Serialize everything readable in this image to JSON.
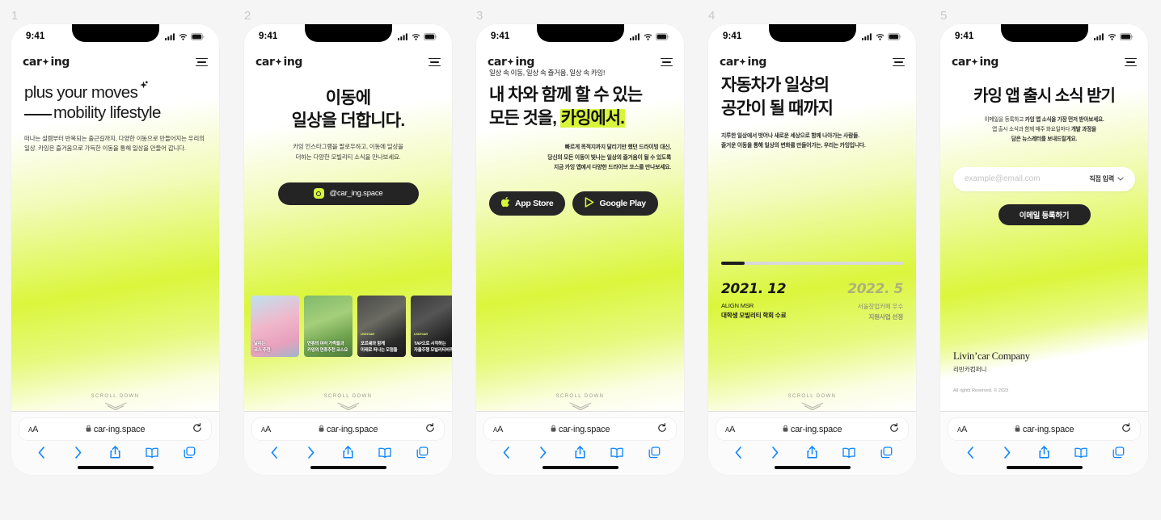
{
  "brand": {
    "logo_pre": "car",
    "logo_post": "ing",
    "accent": "#d8f53c",
    "dark": "#242424"
  },
  "safari": {
    "aa_label": "AA",
    "url": "car-ing.space",
    "lock_icon": "lock-icon",
    "reload_icon": "reload-icon",
    "back_icon": "back-chevron-icon",
    "forward_icon": "forward-chevron-icon",
    "share_icon": "share-icon",
    "bookmarks_icon": "book-icon",
    "tabs_icon": "tabs-icon"
  },
  "status": {
    "time": "9:41",
    "cellular_icon": "cellular-bars-icon",
    "wifi_icon": "wifi-icon",
    "battery_icon": "battery-icon"
  },
  "scroll_hint": {
    "label": "SCROLL DOWN",
    "icon": "chevron-down-icon"
  },
  "frames": [
    {
      "number": "1",
      "headline_line1": "plus your moves",
      "headline_line2": "mobility lifestyle",
      "body": "떠나는 설렘부터 반복되는 출근길까지, 다양한 이동으로 만들어지는 우리의 일상. 카잉은 즐거움으로 가득한 이동을 통해 일상을 만들어 갑니다."
    },
    {
      "number": "2",
      "headline_line1": "이동에",
      "headline_line2": "일상을 더합니다.",
      "sub_line1": "카잉 인스타그램을 팔로우하고, 이동에 일상을",
      "sub_line2": "더하는 다양한 모빌리티 소식을 만나보세요.",
      "instagram_handle": "@car_ing.space",
      "thumbs": [
        {
          "eyebrow": "",
          "caption_line1": "날리는",
          "caption_line2": "코스 추천"
        },
        {
          "eyebrow": "",
          "caption_line1": "연휴의 여러 가족들과",
          "caption_line2": "카잉의 연휴추천 코스요"
        },
        {
          "eyebrow": "LIVIN'CAR",
          "caption_line1": "포르쉐와 함께",
          "caption_line2": "미래로 떠나는 모험들"
        },
        {
          "eyebrow": "LIVIN'CAR",
          "caption_line1": "TAP으로 시작하는",
          "caption_line2": "자율주행 모빌리티바퀴"
        }
      ]
    },
    {
      "number": "3",
      "eyebrow": "일상 속 이동, 일상 속 즐거움, 일상 속 카잉!",
      "headline_line1": "내 차와 함께 할 수 있는",
      "headline_line2_plain": "모든 것을, ",
      "headline_line2_highlight": "카잉에서.",
      "body_line1": "빠르게 목적지까지 달리기만 했던 드라이빙 대신,",
      "body_line2": "당신의 모든 이동이 빛나는 일상의 즐거움이 될 수 있도록",
      "body_line3": "지금 카잉 앱에서 다양한 드라이브 코스를 만나보세요.",
      "appstore_label": "App Store",
      "googleplay_label": "Google Play"
    },
    {
      "number": "4",
      "headline_line1": "자동차가 일상의",
      "headline_line2": "공간이 될 때까지",
      "body_line1": "지루한 일상에서 벗어나 새로운 세상으로 함께 나아가는 사람들.",
      "body_line2": "즐거운 이동을 통해 일상의 변화를 만들어가는, 우리는 카잉입니다.",
      "timeline": [
        {
          "year": "2021. 12",
          "line1": "ALIGN MSR",
          "line2": "대학생 모빌리티 학회 수료",
          "dim": false
        },
        {
          "year": "2022. 5",
          "line1": "서울창업카페 우수",
          "line2": "지원사업 선정",
          "dim": true
        }
      ],
      "progress_percent": 13
    },
    {
      "number": "5",
      "headline": "카잉 앱 출시 소식 받기",
      "sub_line1_a": "이메일을 등록하고 ",
      "sub_line1_b": "카잉 앱 소식을 가장 먼저 받아보세요.",
      "sub_line2_a": "앱 출시 소식과 함께 매주 화요일마다 ",
      "sub_line2_b": "개발 과정을",
      "sub_line3": "담은 뉴스레터를 보내드릴게요.",
      "email_placeholder": "example@email.com",
      "email_value": "",
      "domain_select": "직접 입력",
      "submit_label": "이메일 등록하기",
      "footer_en": "Livin’car Company",
      "footer_kr": "리빈카컴퍼니",
      "footer_rights": "All rights Reserved. © 2023"
    }
  ]
}
